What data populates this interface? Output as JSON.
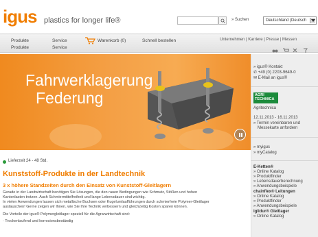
{
  "header": {
    "logo": "igus",
    "tagline": "plastics for longer life®",
    "search_label": "» Suchen",
    "language_selected": "Deutschland (Deutsch"
  },
  "nav": {
    "produkte": "Produkte",
    "service": "Service",
    "cart": "Warenkorb (0)",
    "schnell": "Schnell bestellen",
    "produkte2": "Produkte",
    "service2": "Service",
    "top_links": "Unternehmen  |  Karriere  |  Presse  |  Messen"
  },
  "hero": {
    "title_line1": "Fahrwerklagerung",
    "title_line2": "Federung"
  },
  "sidebar": {
    "contact_title": "» igus® Kontakt",
    "phone": "✆ +49 (0) 2203-9649-0",
    "email": "✉ E-Mail an igus®",
    "agri_logo": "AGRI TECHNICA",
    "agri_name": "Agritechnica",
    "agri_dates": "12.11.2013 - 16.11.2013",
    "agri_link1": "» Termin vereinbaren und",
    "agri_link1b": "Messekarte anfordern",
    "mygus": "» myigus",
    "mycatalog": "» myCatalog",
    "ekette_title": "E-Ketten®",
    "ekette_items": [
      "» Online Katalog",
      "» Produktfinder",
      "» Lebensdauerberechnung",
      "» Anwendungsbeispiele"
    ],
    "chainflex_title": "chainflex® Leitungen",
    "chainflex_items": [
      "» Online Katalog",
      "» Produktfinder",
      "» Anwendungsbeispiele"
    ],
    "iglidur_title": "iglidur® Gleitlager",
    "iglidur_items": [
      "» Online Katalog"
    ]
  },
  "content": {
    "lieferzeit": "Lieferzeit 24 - 48 Std.",
    "heading": "Kunststoff-Produkte in der Landtechnik",
    "subheading": "3 x höhere Standzeiten durch den Einsatz von Kunststoff-Gleitlagern",
    "para1": "Gerade in der Landwirtschaft benötigen Sie Lösungen, die den rauen Bedingungen wie Schmutz, Stößen und hohen",
    "para2": "Kantenlasten trotzen. Auch Schmiermittelfreiheit und lange Lebensdauer sind wichtig.",
    "para3": "In vielen Anwendungen lassen sich metallische Buchsen oder Kugelumlaufführungen durch schmierfreie Polymer-Gleitlager",
    "para4": "austauschen! Gerne zeigen wir Ihnen, wie Sie Ihre Technik verbessern und gleichzeitig Kosten sparen können.",
    "para5": "Die Vorteile der igus® Polymergleitlager speziell für die Agrarwirtschaft sind:",
    "para6": "· Trockenlaufend und korrosionsbeständig"
  },
  "colors": {
    "brand_orange": "#f07d00",
    "hero_orange": "#f4a046",
    "agri_green": "#1c8b3c"
  }
}
